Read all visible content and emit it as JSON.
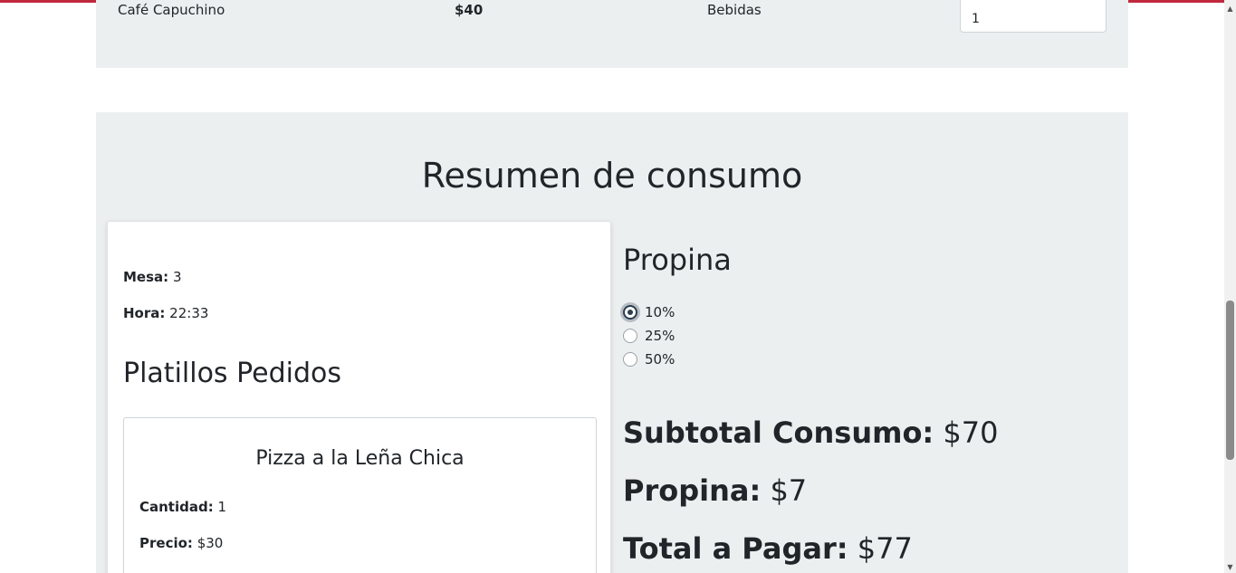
{
  "menu": {
    "row": {
      "name": "Café Capuchino",
      "price": "$40",
      "category": "Bebidas",
      "quantity": "1"
    }
  },
  "summary": {
    "title": "Resumen de consumo",
    "card": {
      "mesa_label": "Mesa:",
      "mesa_value": "3",
      "hora_label": "Hora:",
      "hora_value": "22:33",
      "orders_title": "Platillos Pedidos",
      "dish": {
        "name": "Pizza a la Leña Chica",
        "qty_label": "Cantidad:",
        "qty_value": "1",
        "price_label": "Precio:",
        "price_value": "$30"
      }
    },
    "tip": {
      "title": "Propina",
      "options": [
        {
          "label": "10%",
          "checked": true
        },
        {
          "label": "25%",
          "checked": false
        },
        {
          "label": "50%",
          "checked": false
        }
      ]
    },
    "totals": {
      "subtotal_label": "Subtotal Consumo:",
      "subtotal_value": "$70",
      "tip_label": "Propina:",
      "tip_value": "$7",
      "total_label": "Total a Pagar:",
      "total_value": "$77"
    }
  },
  "colors": {
    "accent": "#c0283c",
    "section_bg": "#eceff0",
    "radio_checked": "#2c3e50"
  }
}
